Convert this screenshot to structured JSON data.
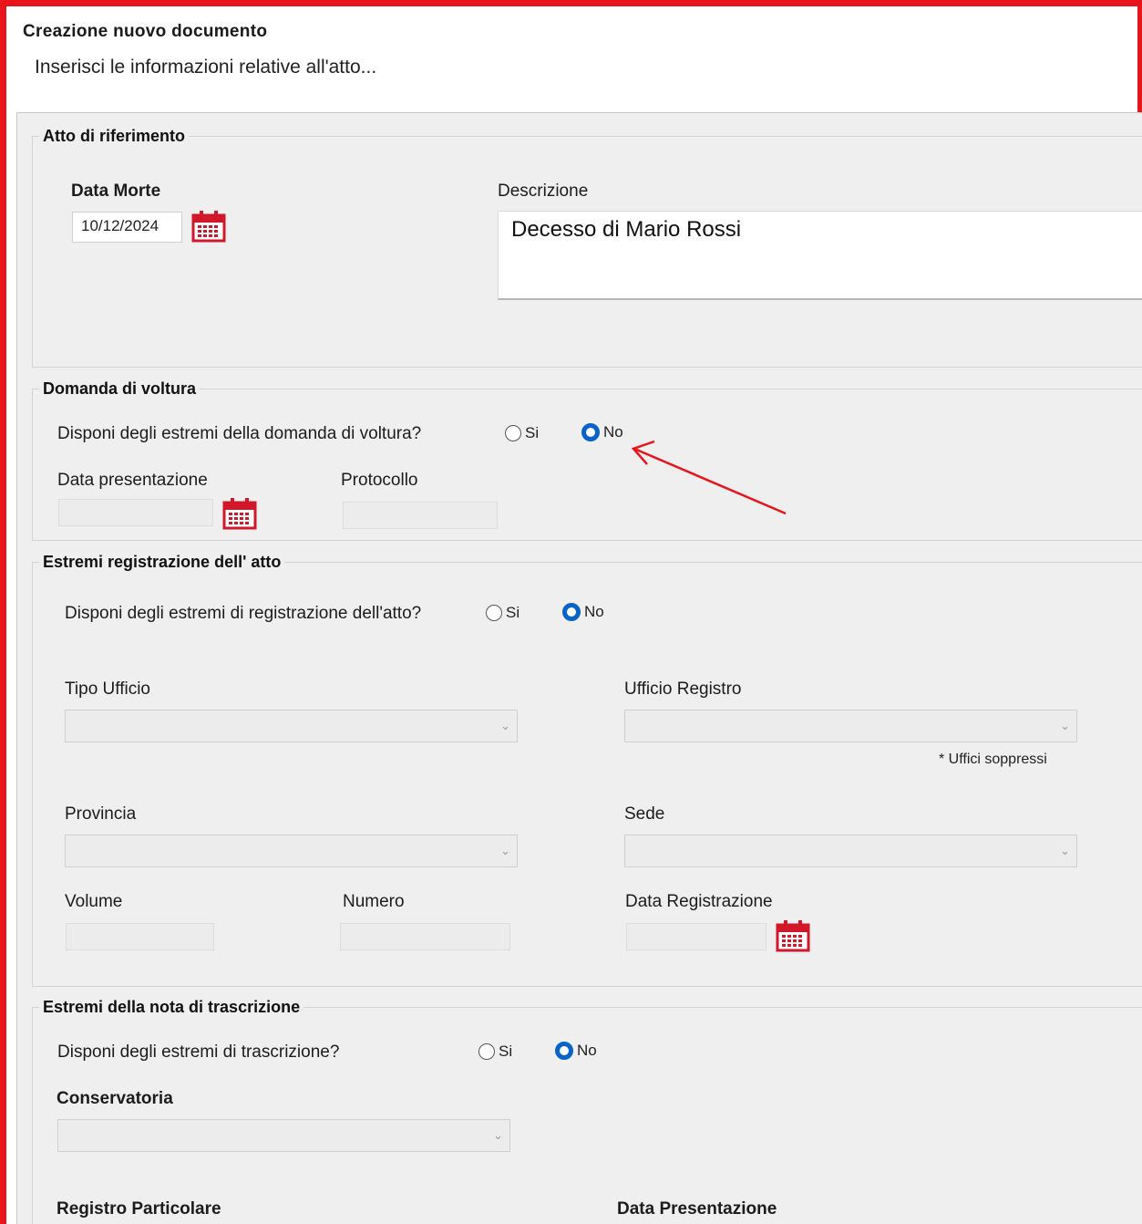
{
  "header": {
    "title": "Creazione nuovo documento",
    "subtitle": "Inserisci le informazioni relative all'atto..."
  },
  "atto": {
    "legend": "Atto di riferimento",
    "data_morte_label": "Data Morte",
    "data_morte_value": "10/12/2024",
    "descrizione_label": "Descrizione",
    "descrizione_value": "Decesso di Mario Rossi"
  },
  "voltura": {
    "legend": "Domanda di voltura",
    "question": "Disponi degli estremi della domanda di voltura?",
    "yes_label": "Si",
    "no_label": "No",
    "selected": "No",
    "data_presentazione_label": "Data presentazione",
    "protocollo_label": "Protocollo"
  },
  "registrazione": {
    "legend": "Estremi registrazione dell' atto",
    "question": "Disponi degli estremi di registrazione dell'atto?",
    "yes_label": "Si",
    "no_label": "No",
    "selected": "No",
    "tipo_ufficio_label": "Tipo Ufficio",
    "ufficio_registro_label": "Ufficio Registro",
    "uffici_soppressi_note": "* Uffici soppressi",
    "provincia_label": "Provincia",
    "sede_label": "Sede",
    "volume_label": "Volume",
    "numero_label": "Numero",
    "data_registrazione_label": "Data Registrazione"
  },
  "trascrizione": {
    "legend": "Estremi della nota di trascrizione",
    "question": "Disponi degli estremi di trascrizione?",
    "yes_label": "Si",
    "no_label": "No",
    "selected": "No",
    "conservatoria_label": "Conservatoria",
    "registro_particolare_label": "Registro Particolare",
    "data_presentazione_label": "Data Presentazione"
  },
  "colors": {
    "frame_border": "#e8141b",
    "annotation_arrow": "#e8141b",
    "radio_selected": "#0a64c8",
    "calendar_icon": "#d3172b"
  },
  "icons": [
    "calendar-icon",
    "chevron-down-icon",
    "annotation-arrow"
  ]
}
